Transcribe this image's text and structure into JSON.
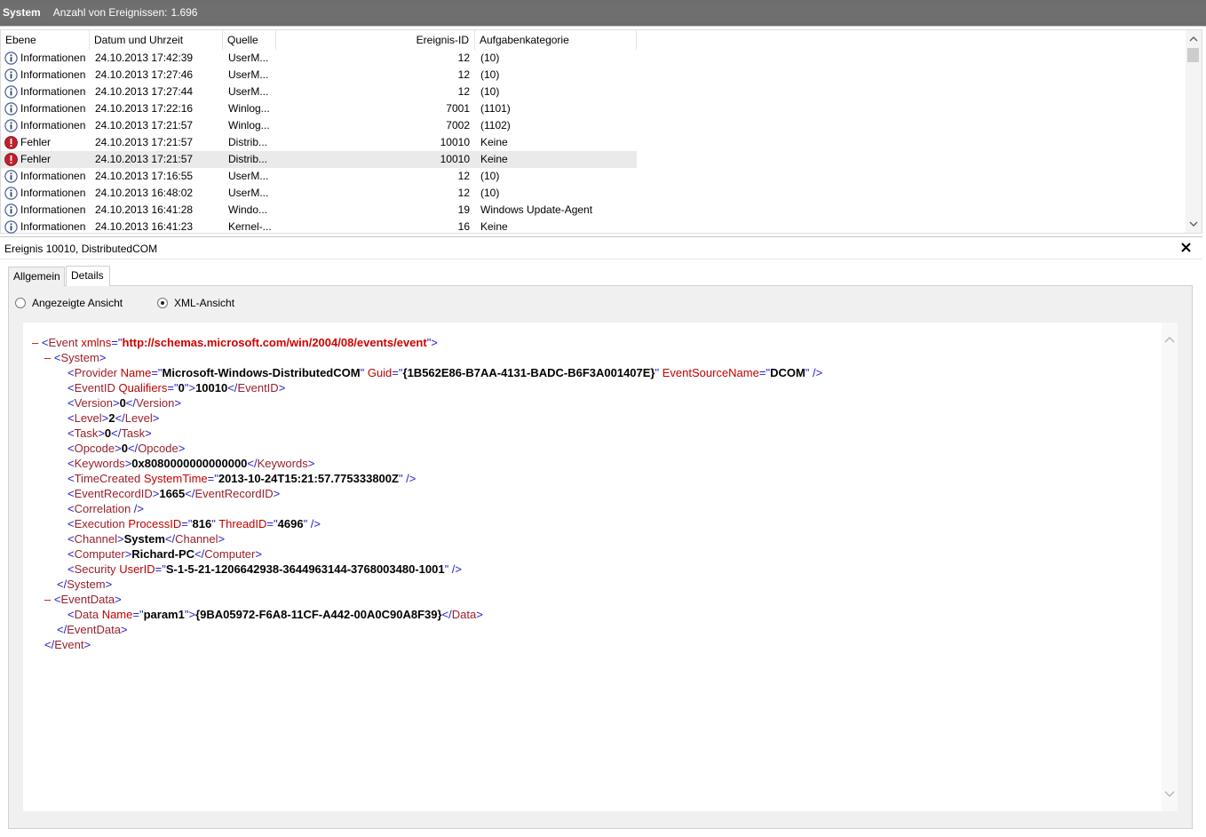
{
  "titlebar": {
    "log_name": "System",
    "count_label": "Anzahl von Ereignissen:",
    "count_value": "1.696"
  },
  "columns": {
    "level": "Ebene",
    "datetime": "Datum und Uhrzeit",
    "source": "Quelle",
    "event_id": "Ereignis-ID",
    "task": "Aufgabenkategorie"
  },
  "events": [
    {
      "icon": "info-icon",
      "level": "Informationen",
      "datetime": "24.10.2013 17:42:39",
      "source": "UserM...",
      "id": "12",
      "task": "(10)"
    },
    {
      "icon": "info-icon",
      "level": "Informationen",
      "datetime": "24.10.2013 17:27:46",
      "source": "UserM...",
      "id": "12",
      "task": "(10)"
    },
    {
      "icon": "info-icon",
      "level": "Informationen",
      "datetime": "24.10.2013 17:27:44",
      "source": "UserM...",
      "id": "12",
      "task": "(10)"
    },
    {
      "icon": "info-icon",
      "level": "Informationen",
      "datetime": "24.10.2013 17:22:16",
      "source": "Winlog...",
      "id": "7001",
      "task": "(1101)"
    },
    {
      "icon": "info-icon",
      "level": "Informationen",
      "datetime": "24.10.2013 17:21:57",
      "source": "Winlog...",
      "id": "7002",
      "task": "(1102)"
    },
    {
      "icon": "error-icon",
      "level": "Fehler",
      "datetime": "24.10.2013 17:21:57",
      "source": "Distrib...",
      "id": "10010",
      "task": "Keine"
    },
    {
      "icon": "error-icon",
      "level": "Fehler",
      "datetime": "24.10.2013 17:21:57",
      "source": "Distrib...",
      "id": "10010",
      "task": "Keine",
      "selected": true
    },
    {
      "icon": "info-icon",
      "level": "Informationen",
      "datetime": "24.10.2013 17:16:55",
      "source": "UserM...",
      "id": "12",
      "task": "(10)"
    },
    {
      "icon": "info-icon",
      "level": "Informationen",
      "datetime": "24.10.2013 16:48:02",
      "source": "UserM...",
      "id": "12",
      "task": "(10)"
    },
    {
      "icon": "info-icon",
      "level": "Informationen",
      "datetime": "24.10.2013 16:41:28",
      "source": "Windo...",
      "id": "19",
      "task": "Windows Update-Agent"
    },
    {
      "icon": "info-icon",
      "level": "Informationen",
      "datetime": "24.10.2013 16:41:23",
      "source": "Kernel-...",
      "id": "16",
      "task": "Keine"
    }
  ],
  "detail": {
    "title": "Ereignis 10010, DistributedCOM",
    "tabs": [
      "Allgemein",
      "Details"
    ],
    "active_tab": "Details",
    "view_options": [
      "Angezeigte Ansicht",
      "XML-Ansicht"
    ],
    "selected_view": "XML-Ansicht"
  },
  "xml": {
    "ns": "http://schemas.microsoft.com/win/2004/08/events/event",
    "provider_name": "Microsoft-Windows-DistributedCOM",
    "provider_guid": "{1B562E86-B7AA-4131-BADC-B6F3A001407E}",
    "event_source_name": "DCOM",
    "qualifiers": "0",
    "event_id": "10010",
    "version": "0",
    "level": "2",
    "task": "0",
    "opcode": "0",
    "keywords": "0x8080000000000000",
    "system_time": "2013-10-24T15:21:57.775333800Z",
    "record_id": "1665",
    "process_id": "816",
    "thread_id": "4696",
    "channel": "System",
    "computer": "Richard-PC",
    "user_id": "S-1-5-21-1206642938-3644963144-3768003480-1001",
    "data_name": "param1",
    "data_value": "{9BA05972-F6A8-11CF-A442-00A0C90A8F39}"
  },
  "colors": {
    "tag": "#9a1f2a",
    "bracket": "#2222cc",
    "attr": "#c00000",
    "title_bg": "#6f6f6f"
  }
}
